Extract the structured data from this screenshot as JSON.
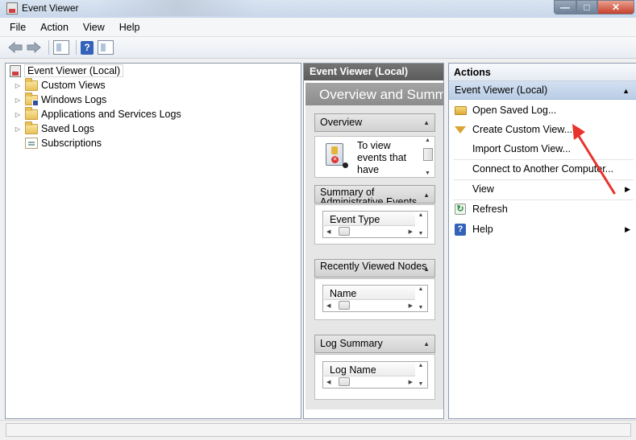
{
  "window": {
    "title": "Event Viewer",
    "controls": {
      "minimize": "—",
      "maximize": "□",
      "close": "✕"
    }
  },
  "menu": [
    "File",
    "Action",
    "View",
    "Help"
  ],
  "toolbar": {
    "icons": [
      "back-arrow-icon",
      "forward-arrow-icon",
      "show-hide-console-tree-icon",
      "help-icon",
      "show-hide-action-pane-icon"
    ],
    "help_glyph": "?"
  },
  "tree": {
    "root": "Event Viewer (Local)",
    "items": [
      {
        "label": "Custom Views",
        "expandable": true
      },
      {
        "label": "Windows Logs",
        "expandable": true
      },
      {
        "label": "Applications and Services Logs",
        "expandable": true
      },
      {
        "label": "Saved Logs",
        "expandable": true
      },
      {
        "label": "Subscriptions",
        "expandable": false
      }
    ]
  },
  "middle": {
    "header": "Event Viewer (Local)",
    "title": "Overview and Summary",
    "overview": {
      "heading": "Overview",
      "text": "To view events that have"
    },
    "summary": {
      "heading": "Summary of Administrative Events",
      "column": "Event Type"
    },
    "recent": {
      "heading": "Recently Viewed Nodes",
      "column": "Name"
    },
    "log_summary": {
      "heading": "Log Summary",
      "column": "Log Name"
    }
  },
  "actions": {
    "header": "Actions",
    "section": "Event Viewer (Local)",
    "items": [
      {
        "label": "Open Saved Log...",
        "icon": "open-folder-icon"
      },
      {
        "label": "Create Custom View...",
        "icon": "filter-icon"
      },
      {
        "label": "Import Custom View...",
        "icon": ""
      },
      {
        "label": "Connect to Another Computer...",
        "icon": ""
      },
      {
        "label": "View",
        "icon": "",
        "submenu": true
      },
      {
        "label": "Refresh",
        "icon": "refresh-icon"
      },
      {
        "label": "Help",
        "icon": "help-icon",
        "submenu": true
      }
    ]
  },
  "colors": {
    "title_bar": "#c8d7ea",
    "actions_section": "#c6d7ec",
    "annotation_arrow": "#e8322c",
    "overview_band": "#8c8c8c"
  }
}
